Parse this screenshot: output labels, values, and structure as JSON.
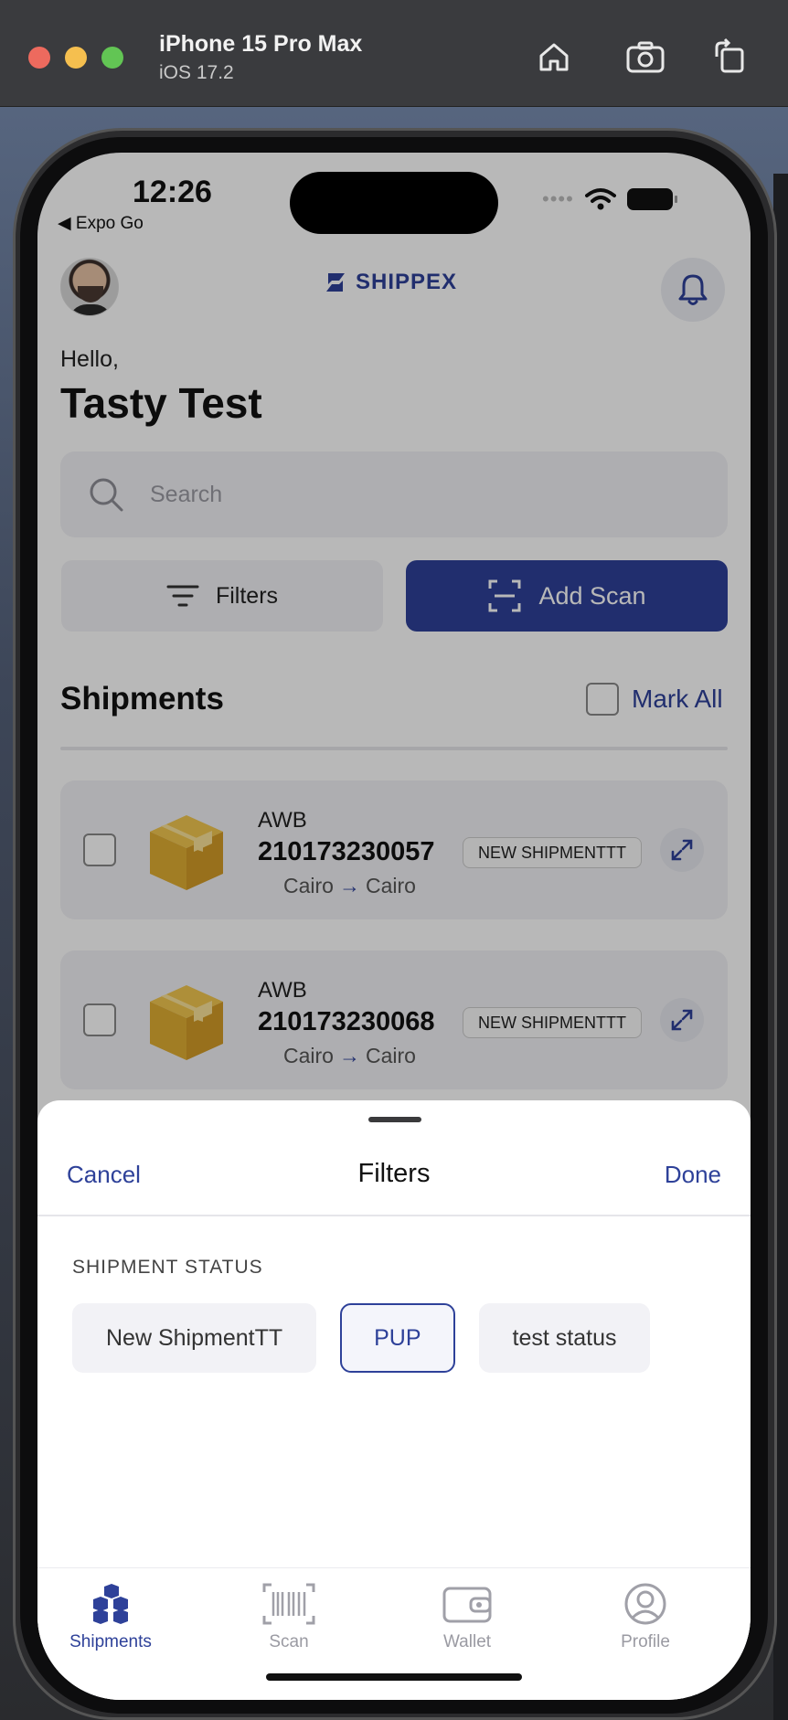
{
  "simulator": {
    "device": "iPhone 15 Pro Max",
    "os": "iOS 17.2"
  },
  "status_bar": {
    "time": "12:26",
    "back_app": "Expo Go"
  },
  "header": {
    "logo_text": "SHIPPEX"
  },
  "greeting": {
    "hello": "Hello,",
    "name": "Tasty Test"
  },
  "search": {
    "placeholder": "Search"
  },
  "actions": {
    "filters_label": "Filters",
    "add_scan_label": "Add Scan"
  },
  "shipments": {
    "title": "Shipments",
    "mark_all_label": "Mark All",
    "items": [
      {
        "awb_label": "AWB",
        "awb_number": "210173230057",
        "from": "Cairo",
        "to": "Cairo",
        "status": "NEW SHIPMENTTT"
      },
      {
        "awb_label": "AWB",
        "awb_number": "210173230068",
        "from": "Cairo",
        "to": "Cairo",
        "status": "NEW SHIPMENTTT"
      }
    ]
  },
  "filters_sheet": {
    "cancel_label": "Cancel",
    "title": "Filters",
    "done_label": "Done",
    "section_heading": "SHIPMENT STATUS",
    "chips": [
      {
        "label": "New ShipmentTT",
        "selected": false
      },
      {
        "label": "PUP",
        "selected": true
      },
      {
        "label": "test status",
        "selected": false
      }
    ]
  },
  "tabbar": {
    "tabs": [
      {
        "label": "Shipments",
        "icon": "boxes-icon",
        "active": true
      },
      {
        "label": "Scan",
        "icon": "barcode-icon",
        "active": false
      },
      {
        "label": "Wallet",
        "icon": "wallet-icon",
        "active": false
      },
      {
        "label": "Profile",
        "icon": "profile-icon",
        "active": false
      }
    ]
  },
  "colors": {
    "brand": "#2e4199",
    "box": "#e6b53a"
  }
}
